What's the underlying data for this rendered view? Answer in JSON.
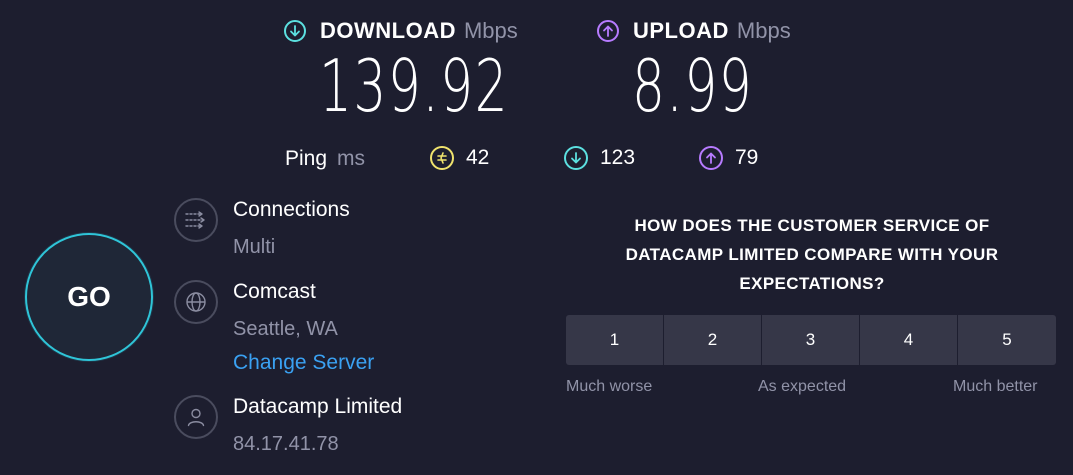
{
  "download": {
    "label": "DOWNLOAD",
    "unit": "Mbps",
    "value": "139.92",
    "color": "#5ce0e0"
  },
  "upload": {
    "label": "UPLOAD",
    "unit": "Mbps",
    "value": "8.99",
    "color": "#b77bff"
  },
  "ping": {
    "label": "Ping",
    "unit": "ms",
    "idle": {
      "value": "42",
      "icon": "ping-bolt-icon",
      "color": "#f0e36d"
    },
    "download": {
      "value": "123",
      "icon": "arrow-down-icon",
      "color": "#5ce0e0"
    },
    "upload": {
      "value": "79",
      "icon": "arrow-up-icon",
      "color": "#b77bff"
    }
  },
  "go_button": {
    "label": "GO",
    "color": "#2fc5d8"
  },
  "connections": {
    "title": "Connections",
    "value": "Multi",
    "icon": "connections-icon"
  },
  "server": {
    "provider": "Comcast",
    "location": "Seattle, WA",
    "change_label": "Change Server",
    "icon": "globe-icon"
  },
  "host": {
    "name": "Datacamp Limited",
    "ip": "84.17.41.78",
    "icon": "user-icon"
  },
  "survey": {
    "question_lines": [
      "HOW DOES THE CUSTOMER SERVICE OF",
      "DATACAMP LIMITED COMPARE WITH YOUR",
      "EXPECTATIONS?"
    ],
    "options": [
      "1",
      "2",
      "3",
      "4",
      "5"
    ],
    "label_low": "Much worse",
    "label_mid": "As expected",
    "label_high": "Much better"
  }
}
